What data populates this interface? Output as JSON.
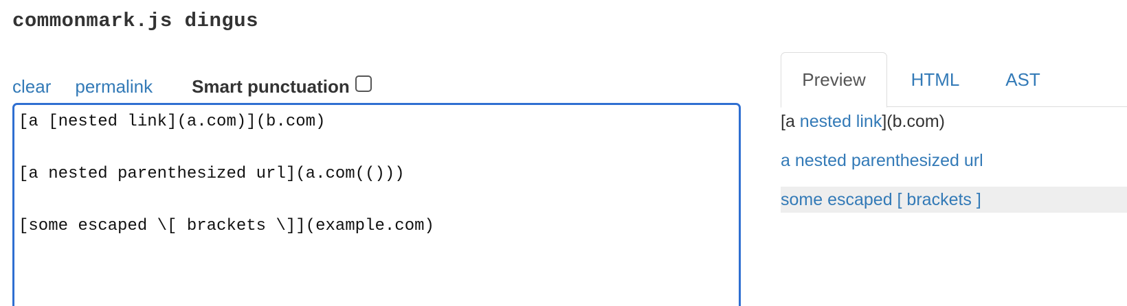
{
  "header": {
    "title": "commonmark.js dingus"
  },
  "toolbar": {
    "clear_label": "clear",
    "permalink_label": "permalink",
    "smart_punctuation_label": "Smart punctuation",
    "smart_punctuation_checked": false
  },
  "editor": {
    "lines": [
      "[a [nested link](a.com)](b.com)",
      "",
      "[a nested parenthesized url](a.com(()))",
      "",
      "[some escaped \\[ brackets \\]](example.com)"
    ]
  },
  "tabs": {
    "items": [
      {
        "label": "Preview",
        "active": true
      },
      {
        "label": "HTML",
        "active": false
      },
      {
        "label": "AST",
        "active": false
      }
    ]
  },
  "preview": {
    "p1_before": "[a ",
    "p1_link": "nested link",
    "p1_after": "](b.com)",
    "p2_link": "a nested parenthesized url",
    "p3_link": "some escaped [ brackets ]"
  },
  "colors": {
    "link": "#337ab7",
    "editor_border": "#2f6fd1",
    "highlight_row": "#eeeeee"
  }
}
